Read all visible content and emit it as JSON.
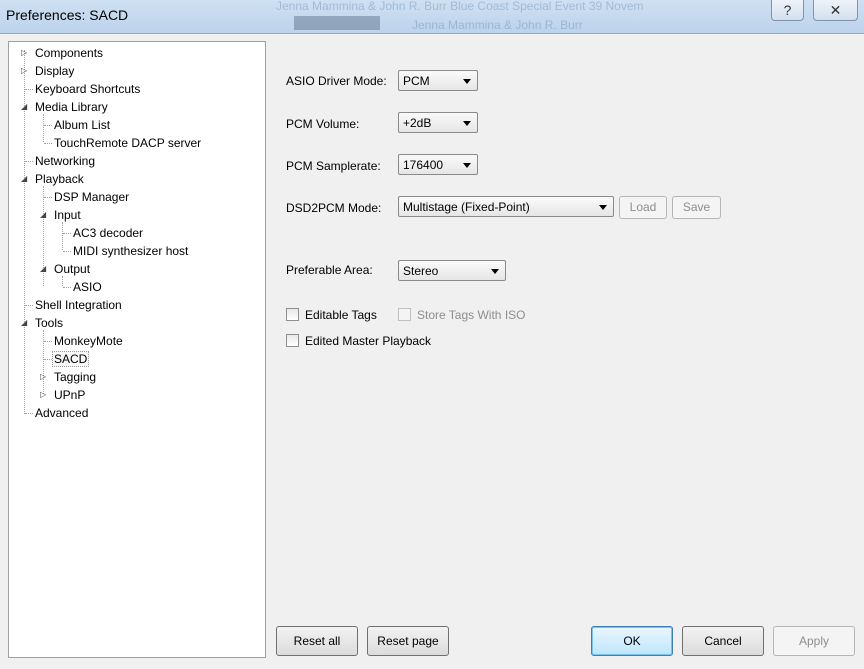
{
  "window": {
    "title": "Preferences: SACD",
    "help_glyph": "?",
    "close_glyph": "✕"
  },
  "background_window": {
    "text_row1": "Jenna Mammina & John R. Burr    Blue Coast Special Event 39 Novem",
    "text_row2": "Jenna Mammina & John R. Burr"
  },
  "tree": {
    "components": "Components",
    "display": "Display",
    "keyboard_shortcuts": "Keyboard Shortcuts",
    "media_library": "Media Library",
    "album_list": "Album List",
    "touchremote": "TouchRemote DACP server",
    "networking": "Networking",
    "playback": "Playback",
    "dsp_manager": "DSP Manager",
    "input": "Input",
    "ac3_decoder": "AC3 decoder",
    "midi_host": "MIDI synthesizer host",
    "output": "Output",
    "asio": "ASIO",
    "shell_integration": "Shell Integration",
    "tools": "Tools",
    "monkeymote": "MonkeyMote",
    "sacd": "SACD",
    "tagging": "Tagging",
    "upnp": "UPnP",
    "advanced": "Advanced",
    "collapsed_glyph": "▷",
    "expanded_glyph": "◢"
  },
  "settings": {
    "asio_driver_mode": {
      "label": "ASIO Driver Mode:",
      "value": "PCM"
    },
    "pcm_volume": {
      "label": "PCM Volume:",
      "value": "+2dB"
    },
    "pcm_samplerate": {
      "label": "PCM Samplerate:",
      "value": "176400"
    },
    "dsd2pcm_mode": {
      "label": "DSD2PCM Mode:",
      "value": "Multistage (Fixed-Point)",
      "load": "Load",
      "save": "Save"
    },
    "preferable_area": {
      "label": "Preferable Area:",
      "value": "Stereo"
    },
    "editable_tags": {
      "label": "Editable Tags",
      "checked": false
    },
    "store_tags_with_iso": {
      "label": "Store Tags With ISO",
      "checked": false,
      "enabled": false
    },
    "edited_master_playback": {
      "label": "Edited Master Playback",
      "checked": false
    }
  },
  "footer": {
    "reset_all": "Reset all",
    "reset_page": "Reset page",
    "ok": "OK",
    "cancel": "Cancel",
    "apply": "Apply"
  }
}
